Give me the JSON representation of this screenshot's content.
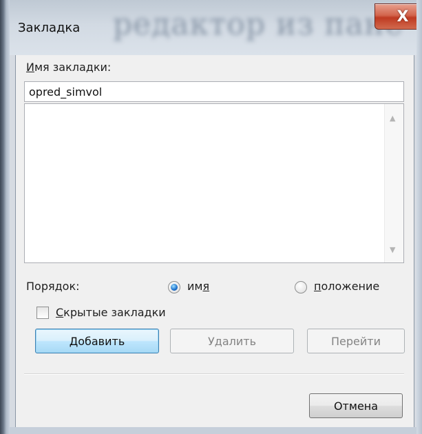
{
  "window": {
    "title": "Закладка",
    "background_blur_text": "редактор из пане",
    "close_glyph": "X"
  },
  "bookmark_name": {
    "label_mnemonic": "И",
    "label_rest": "мя закладки:",
    "value": "opred_simvol"
  },
  "bookmarks_list": {
    "items": [],
    "scroll_up_glyph": "▲",
    "scroll_down_glyph": "▼"
  },
  "order": {
    "label": "Порядок:",
    "name_option": {
      "pre": "им",
      "mnemonic": "я",
      "post": "",
      "selected": true
    },
    "position_option": {
      "pre": "",
      "mnemonic": "п",
      "post": "оложение",
      "selected": false
    }
  },
  "hidden_bookmarks": {
    "mnemonic": "С",
    "rest": "крытые закладки",
    "checked": false
  },
  "buttons": {
    "add_mnemonic": "Д",
    "add_rest": "обавить",
    "delete": "Удалить",
    "go_to": "Перейти",
    "cancel": "Отмена"
  },
  "colors": {
    "client_background": "#f0f0f0",
    "default_button_border": "#3c7fb1",
    "close_button_red": "#c9472d",
    "disabled_text": "#838383"
  },
  "icons": {
    "close": "close-icon",
    "radio_checked": "radio-checked-icon",
    "radio_unchecked": "radio-unchecked-icon",
    "checkbox": "checkbox-icon"
  }
}
